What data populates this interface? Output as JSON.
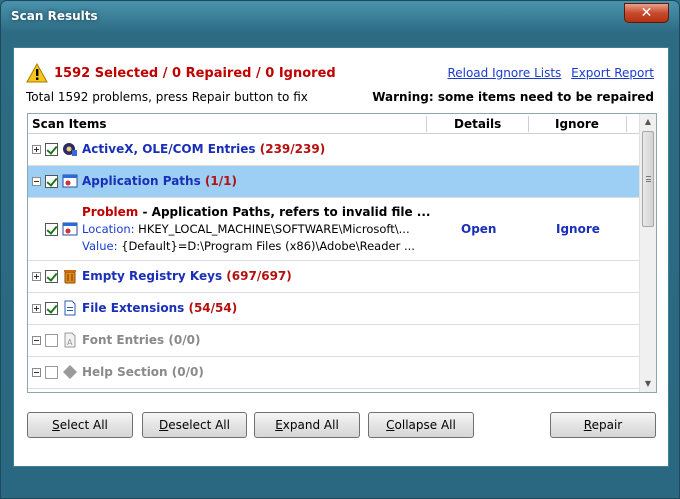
{
  "window": {
    "title": "Scan Results",
    "close_glyph": "✕"
  },
  "summary": {
    "headline": "1592 Selected / 0 Repaired / 0 Ignored",
    "subline": "Total 1592 problems, press Repair button to fix",
    "warning": "Warning: some items need to be repaired",
    "links": [
      "Reload Ignore Lists",
      "Export Report"
    ]
  },
  "table": {
    "headers": {
      "items": "Scan Items",
      "details": "Details",
      "ignore": "Ignore"
    },
    "rows": [
      {
        "label": "ActiveX, OLE/COM Entries",
        "count": "(239/239)",
        "icon": "activex-gear-icon"
      },
      {
        "label": "Application Paths",
        "count": "(1/1)",
        "icon": "application-window-icon"
      },
      {
        "label": "Empty Registry Keys",
        "count": "(697/697)",
        "icon": "trash-bin-icon"
      },
      {
        "label": "File Extensions",
        "count": "(54/54)",
        "icon": "file-document-icon"
      },
      {
        "label": "Font Entries",
        "count": "(0/0)",
        "icon": "font-file-icon"
      },
      {
        "label": "Help Section",
        "count": "(0/0)",
        "icon": "help-diamond-icon"
      }
    ],
    "detail": {
      "problem_key": "Problem",
      "problem_text": "Application Paths, refers to invalid file ...",
      "location_key": "Location:",
      "location_value": "HKEY_LOCAL_MACHINE\\SOFTWARE\\Microsoft\\...",
      "value_key": "Value:",
      "value_value": "{Default}=D:\\Program Files (x86)\\Adobe\\Reader ...",
      "open_label": "Open",
      "ignore_label": "Ignore"
    }
  },
  "buttons": {
    "select_all": {
      "u": "S",
      "rest": "elect All"
    },
    "deselect_all": {
      "u": "D",
      "rest": "eselect All"
    },
    "expand_all": {
      "u": "E",
      "rest": "xpand All"
    },
    "collapse_all": {
      "u": "C",
      "rest": "ollapse All"
    },
    "repair": {
      "u": "R",
      "rest": "epair"
    }
  },
  "colors": {
    "accent_red": "#c00000",
    "link_blue": "#1a3ccd",
    "category_blue": "#1a2fb8",
    "selected_row": "#9ccff3",
    "title_bar": "#2d6b83"
  }
}
